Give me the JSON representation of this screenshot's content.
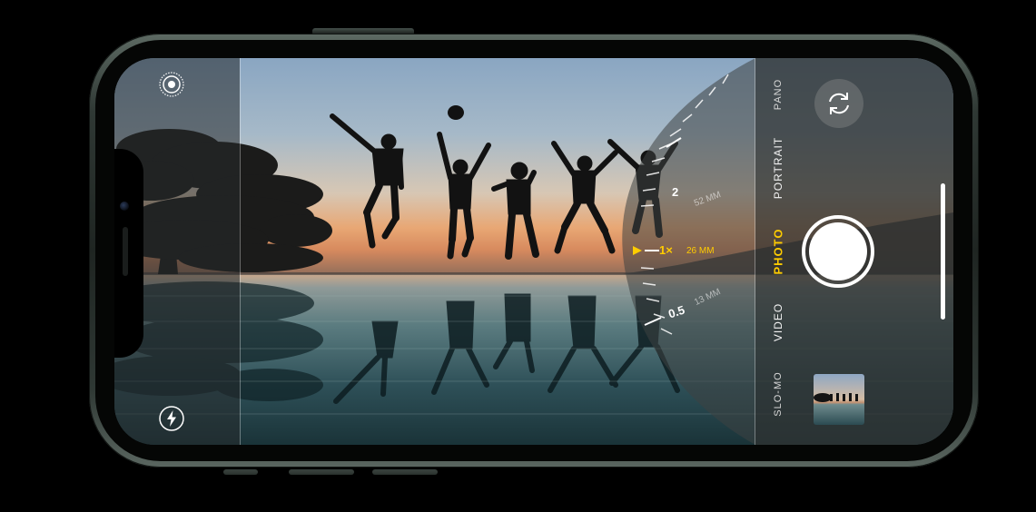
{
  "camera": {
    "modes": [
      {
        "label": "SLO-MO",
        "active": false
      },
      {
        "label": "VIDEO",
        "active": false
      },
      {
        "label": "PHOTO",
        "active": true
      },
      {
        "label": "PORTRAIT",
        "active": false
      },
      {
        "label": "PANO",
        "active": false
      }
    ],
    "zoom": {
      "levels": [
        {
          "label": "0.5",
          "mm": "13 MM"
        },
        {
          "label": "1×",
          "mm": "26 MM",
          "selected": true
        },
        {
          "label": "2",
          "mm": "52 MM"
        }
      ]
    },
    "icons": {
      "live_photo": "live-photo-icon",
      "flash": "flash-icon",
      "flip_camera": "flip-camera-icon"
    },
    "colors": {
      "active_mode": "#ffcc00",
      "text": "#f2f2f2",
      "phone_frame": "#2f3834"
    }
  }
}
